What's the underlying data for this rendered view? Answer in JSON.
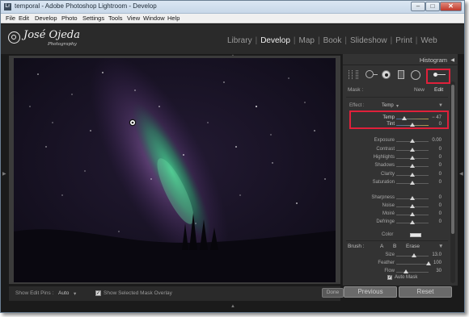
{
  "window": {
    "title": "temporal - Adobe Photoshop Lightroom - Develop",
    "app_icon": "Lr"
  },
  "menu": [
    "File",
    "Edit",
    "Develop",
    "Photo",
    "Settings",
    "Tools",
    "View",
    "Window",
    "Help"
  ],
  "identity": {
    "name": "José Ojeda",
    "sub": "Photography"
  },
  "modules": [
    "Library",
    "Develop",
    "Map",
    "Book",
    "Slideshow",
    "Print",
    "Web"
  ],
  "active_module": "Develop",
  "panel": {
    "histogram_label": "Histogram",
    "mask_label": "Mask :",
    "mask_new": "New",
    "mask_edit": "Edit",
    "effect_label": "Effect :",
    "effect_value": "Temp",
    "sliders": [
      {
        "label": "Temp",
        "value": "− 47",
        "pos": 0.25
      },
      {
        "label": "Tint",
        "value": "0",
        "pos": 0.5
      },
      {
        "label": "Exposure",
        "value": "0.00",
        "pos": 0.5
      },
      {
        "label": "Contrast",
        "value": "0",
        "pos": 0.5
      },
      {
        "label": "Highlights",
        "value": "0",
        "pos": 0.5
      },
      {
        "label": "Shadows",
        "value": "0",
        "pos": 0.5
      },
      {
        "label": "Clarity",
        "value": "0",
        "pos": 0.5
      },
      {
        "label": "Saturation",
        "value": "0",
        "pos": 0.5
      },
      {
        "label": "Sharpness",
        "value": "0",
        "pos": 0.5
      },
      {
        "label": "Noise",
        "value": "0",
        "pos": 0.5
      },
      {
        "label": "Moiré",
        "value": "0",
        "pos": 0.5
      },
      {
        "label": "Defringe",
        "value": "0",
        "pos": 0.5
      }
    ],
    "color_label": "Color",
    "brush": {
      "label": "Brush :",
      "a": "A",
      "b": "B",
      "erase": "Erase"
    },
    "brush_sliders": [
      {
        "label": "Size",
        "value": "13.0",
        "pos": 0.55
      },
      {
        "label": "Feather",
        "value": "100",
        "pos": 1.0
      },
      {
        "label": "Flow",
        "value": "30",
        "pos": 0.3
      }
    ],
    "auto_mask": "Auto Mask",
    "previous": "Previous",
    "reset": "Reset"
  },
  "toolbar": {
    "show_edit_pins_label": "Show Edit Pins :",
    "show_edit_pins_value": "Auto",
    "show_overlay_label": "Show Selected Mask Overlay",
    "done_label": "Done"
  }
}
